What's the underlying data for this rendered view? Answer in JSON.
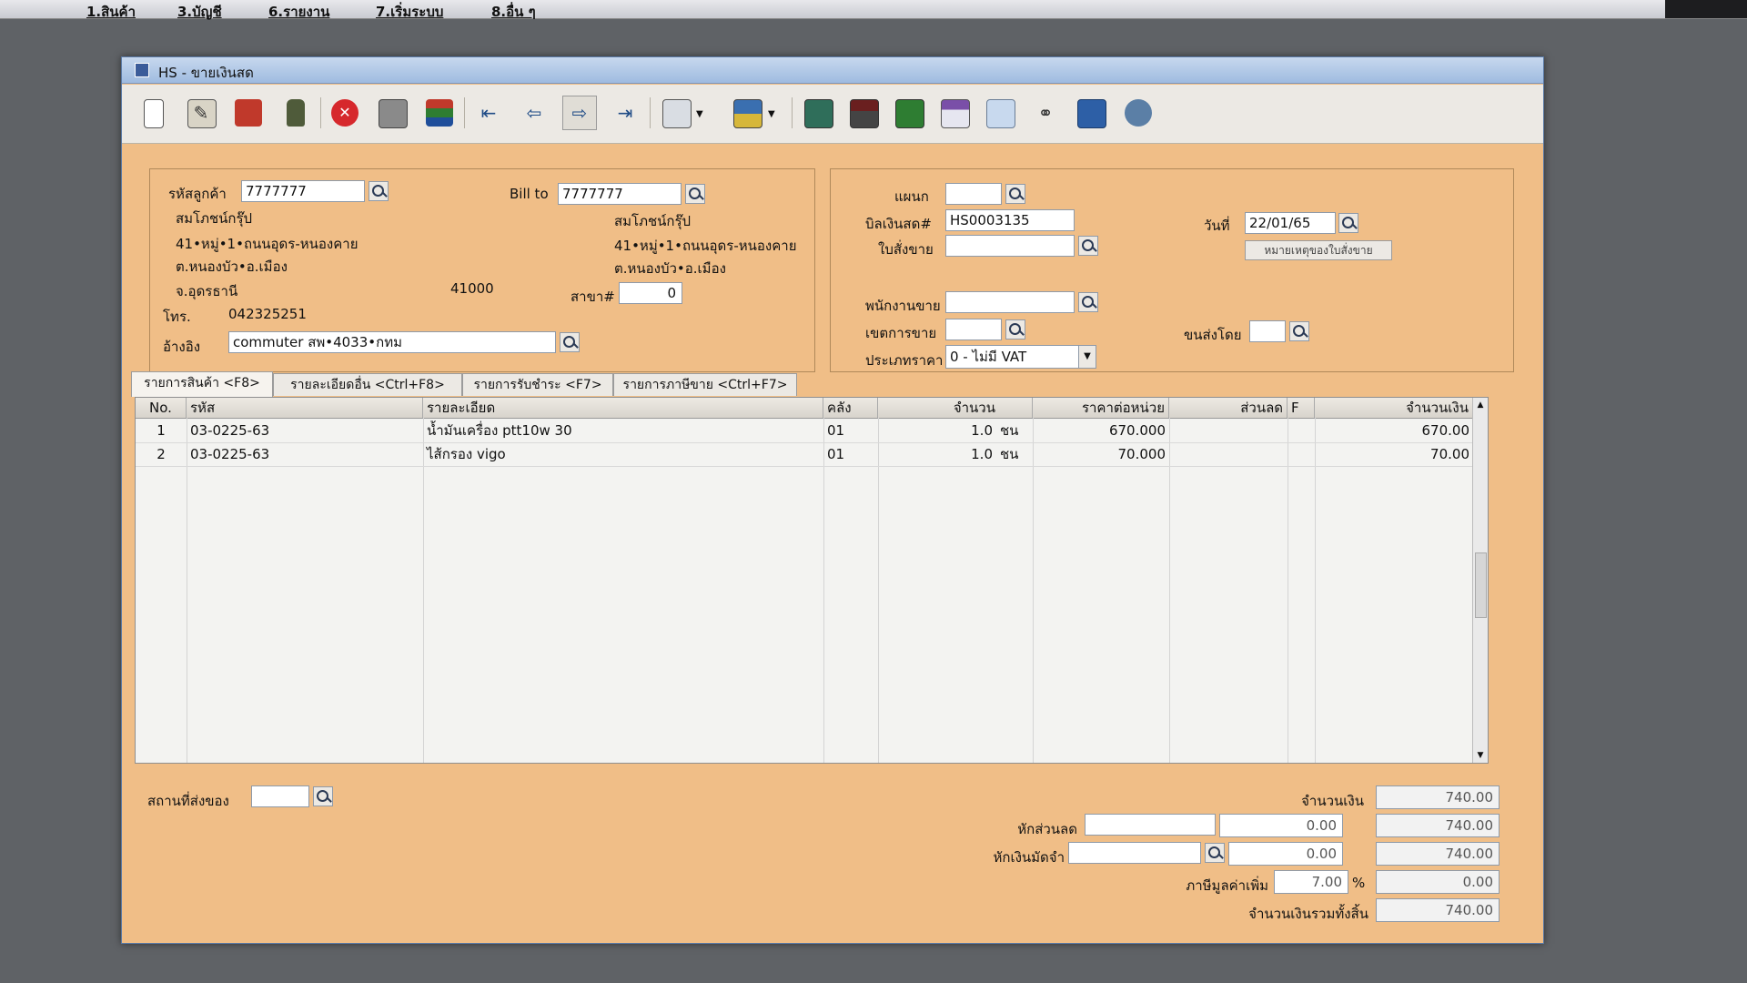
{
  "menubar": {
    "items": [
      "1.สินค้า",
      "3.บัญชี",
      "6.รายงาน",
      "7.เริ่มระบบ",
      "8.อื่น ๆ"
    ]
  },
  "window": {
    "title": "HS - ขายเงินสด"
  },
  "toolbar": {
    "buttons": [
      "new-icon",
      "edit-icon",
      "void-icon",
      "delete-icon",
      "cancel-icon",
      "save-icon",
      "books-icon",
      "first-record-icon",
      "previous-icon",
      "next-icon",
      "last-record-icon",
      "preview-icon",
      "print-icon",
      "calculator-icon",
      "form-icon",
      "report-icon",
      "calendar-icon",
      "approve-icon",
      "link-icon",
      "ok-icon",
      "network-icon"
    ]
  },
  "customer": {
    "code_label": "รหัสลูกค้า",
    "code": "7777777",
    "name": "สมโภชน์กรุ๊ป",
    "address1": "41•หมู่•1•ถนนอุดร-หนองคาย",
    "address2": "ต.หนองบัว•อ.เมือง",
    "province": "จ.อุดรธานี",
    "postcode": "41000",
    "phone_label": "โทร.",
    "phone": "042325251",
    "ref_label": "อ้างอิง",
    "ref": "commuter สพ•4033•กทม"
  },
  "billto": {
    "label": "Bill to",
    "code": "7777777",
    "name": "สมโภชน์กรุ๊ป",
    "address1": "41•หมู่•1•ถนนอุดร-หนองคาย",
    "address2": "ต.หนองบัว•อ.เมือง",
    "branch_label": "สาขา#",
    "branch": "0"
  },
  "doc": {
    "dept_label": "แผนก",
    "dept": "",
    "bill_label": "บิลเงินสด#",
    "bill_no": "HS0003135",
    "date_label": "วันที่",
    "date": "22/01/65",
    "so_label": "ใบสั่งขาย",
    "so": "",
    "so_note_button": "หมายเหตุของใบสั่งขาย",
    "salesman_label": "พนักงานขาย",
    "salesman": "",
    "area_label": "เขตการขาย",
    "area": "",
    "ship_label": "ขนส่งโดย",
    "ship": "",
    "pricetype_label": "ประเภทราคา",
    "pricetype": "0 - ไม่มี VAT"
  },
  "tabs": [
    "รายการสินค้า <F8>",
    "รายละเอียดอื่น <Ctrl+F8>",
    "รายการรับชำระ <F7>",
    "รายการภาษีขาย <Ctrl+F7>"
  ],
  "grid": {
    "columns": [
      "No.",
      "รหัส",
      "รายละเอียด",
      "คลัง",
      "จำนวน",
      "ราคาต่อหน่วย",
      "ส่วนลด",
      "F",
      "จำนวนเงิน"
    ],
    "rows": [
      {
        "no": "1",
        "code": "03-0225-63",
        "desc": "น้ำมันเครื่อง ptt10w 30",
        "wh": "01",
        "qty": "1.0",
        "unit": "ชน",
        "price": "670.000",
        "disc": "",
        "f": "",
        "amount": "670.00"
      },
      {
        "no": "2",
        "code": "03-0225-63",
        "desc": "ไส้กรอง vigo",
        "wh": "01",
        "qty": "1.0",
        "unit": "ชน",
        "price": "70.000",
        "disc": "",
        "f": "",
        "amount": "70.00"
      }
    ]
  },
  "footer": {
    "ship_place_label": "สถานที่ส่งของ",
    "ship_place": "",
    "amount_label": "จำนวนเงิน",
    "amount": "740.00",
    "discount_label": "หักส่วนลด",
    "discount_value": "0.00",
    "discount_total": "740.00",
    "deposit_label": "หักเงินมัดจำ",
    "deposit_value": "0.00",
    "deposit_total": "740.00",
    "vat_label": "ภาษีมูลค่าเพิ่ม",
    "vat_rate": "7.00",
    "vat_unit": "%",
    "vat_amount": "0.00",
    "grand_label": "จำนวนเงินรวมทั้งสิ้น",
    "grand_total": "740.00"
  }
}
